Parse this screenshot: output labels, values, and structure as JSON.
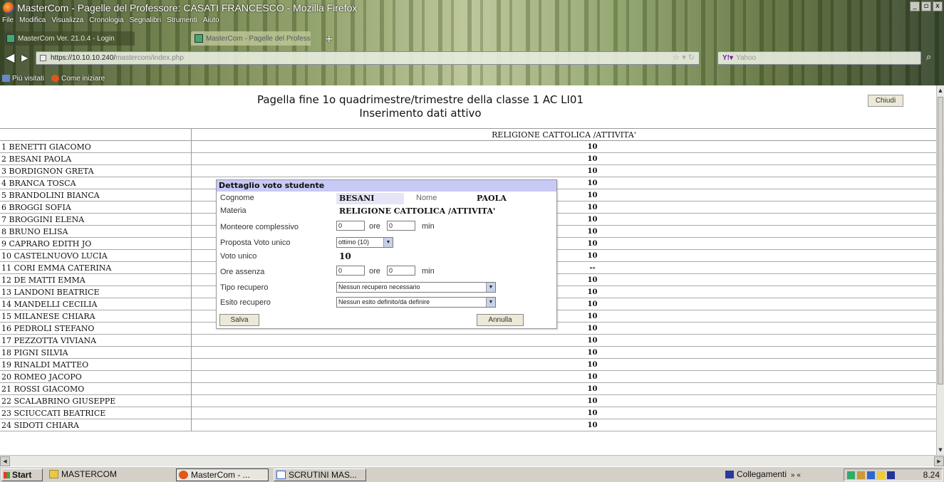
{
  "browser": {
    "title": "MasterCom - Pagelle del Professore: CASATI FRANCESCO - Mozilla Firefox",
    "menu": [
      "File",
      "Modifica",
      "Visualizza",
      "Cronologia",
      "Segnalibri",
      "Strumenti",
      "Aiuto"
    ],
    "tabs": [
      {
        "label": "MasterCom Ver. 21.0.4 - Login"
      },
      {
        "label": "MasterCom - Pagelle del Professore"
      }
    ],
    "url_host": "https://10.10.10.240/",
    "url_path": "mastercom/index.php",
    "search_placeholder": "Yahoo",
    "bookmarks": [
      "Più visitati",
      "Come iniziare"
    ],
    "window_controls": [
      "_",
      "▫",
      "x"
    ]
  },
  "page": {
    "header_line1": "Pagella fine 1o quadrimestre/trimestre della classe 1 AC LI01",
    "header_line2": "Inserimento dati attivo",
    "close_button": "Chiudi",
    "subject_header": "RELIGIONE CATTOLICA /ATTIVITA'",
    "students": [
      {
        "name": " 1 BENETTI GIACOMO",
        "grade": "10"
      },
      {
        "name": " 2 BESANI PAOLA",
        "grade": "10"
      },
      {
        "name": " 3 BORDIGNON GRETA",
        "grade": "10"
      },
      {
        "name": " 4 BRANCA TOSCA",
        "grade": "10"
      },
      {
        "name": " 5 BRANDOLINI BIANCA",
        "grade": "10"
      },
      {
        "name": " 6 BROGGI SOFIA",
        "grade": "10"
      },
      {
        "name": " 7 BROGGINI ELENA",
        "grade": "10"
      },
      {
        "name": " 8 BRUNO ELISA",
        "grade": "10"
      },
      {
        "name": " 9 CAPRARO EDITH JO",
        "grade": "10"
      },
      {
        "name": "10 CASTELNUOVO LUCIA",
        "grade": "10"
      },
      {
        "name": "11 CORI EMMA CATERINA",
        "grade": "--"
      },
      {
        "name": "12 DE MATTI EMMA",
        "grade": "10"
      },
      {
        "name": "13 LANDONI BEATRICE",
        "grade": "10"
      },
      {
        "name": "14 MANDELLI CECILIA",
        "grade": "10"
      },
      {
        "name": "15 MILANESE CHIARA",
        "grade": "10"
      },
      {
        "name": "16 PEDROLI STEFANO",
        "grade": "10"
      },
      {
        "name": "17 PEZZOTTA VIVIANA",
        "grade": "10"
      },
      {
        "name": "18 PIGNI SILVIA",
        "grade": "10"
      },
      {
        "name": "19 RINALDI MATTEO",
        "grade": "10"
      },
      {
        "name": "20 ROMEO JACOPO",
        "grade": "10"
      },
      {
        "name": "21 ROSSI GIACOMO",
        "grade": "10"
      },
      {
        "name": "22 SCALABRINO GIUSEPPE",
        "grade": "10"
      },
      {
        "name": "23 SCIUCCATI BEATRICE",
        "grade": "10"
      },
      {
        "name": "24 SIDOTI CHIARA",
        "grade": "10"
      }
    ]
  },
  "modal": {
    "title": "Dettaglio voto studente",
    "cognome_label": "Cognome",
    "cognome_value": "BESANI",
    "nome_label": "Nome",
    "nome_value": "PAOLA",
    "materia_label": "Materia",
    "materia_value": "RELIGIONE CATTOLICA /ATTIVITA'",
    "monteore_label": "Monteore complessivo",
    "monteore_ore": "0",
    "monteore_min": "0",
    "ore_label": "ore",
    "min_label": "min",
    "proposta_label": "Proposta Voto unico",
    "proposta_value": "ottimo (10)",
    "voto_label": "Voto unico",
    "voto_value": "10",
    "assenza_label": "Ore assenza",
    "assenza_ore": "0",
    "assenza_min": "0",
    "tipo_label": "Tipo recupero",
    "tipo_value": "Nessun recupero necessario",
    "esito_label": "Esito recupero",
    "esito_value": "Nessun esito definito/da definire",
    "save_button": "Salva",
    "cancel_button": "Annulla"
  },
  "taskbar": {
    "start": "Start",
    "items": [
      "MASTERCOM",
      "MasterCom - ...",
      "SCRUTINI MAS..."
    ],
    "links_label": "Collegamenti",
    "clock": "8.24"
  },
  "colors": {
    "modal_title_bg": "#c8c9f5",
    "field_bg": "#e4e6f7",
    "taskbar_bg": "#d4d0c8"
  }
}
